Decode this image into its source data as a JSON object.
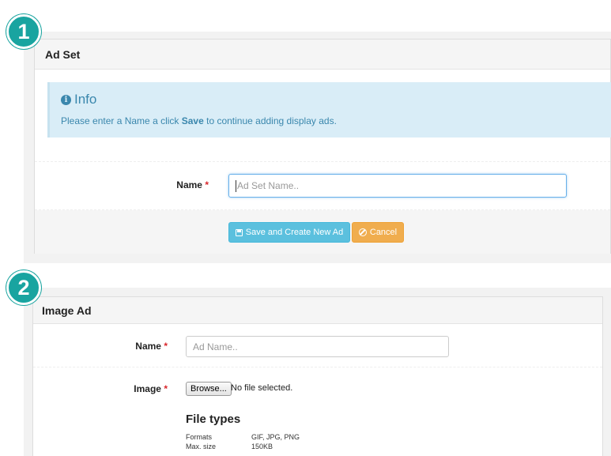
{
  "step1": {
    "badge": "1",
    "header": "Ad Set",
    "info": {
      "title": "Info",
      "text_before": "Please enter a Name a click ",
      "text_bold": "Save",
      "text_after": " to continue adding display ads."
    },
    "name_label": "Name",
    "required_mark": "*",
    "name_placeholder": "Ad Set Name..",
    "save_button": "Save and Create New Ad",
    "cancel_button": "Cancel"
  },
  "step2": {
    "badge": "2",
    "header": "Image Ad",
    "name_label": "Name",
    "required_mark": "*",
    "name_placeholder": "Ad Name..",
    "image_label": "Image",
    "browse_button": "Browse...",
    "no_file_text": "No file selected.",
    "file_types": {
      "title": "File types",
      "rows": [
        {
          "key": "Formats",
          "value": "GIF, JPG, PNG"
        },
        {
          "key": "Max. size",
          "value": "150KB"
        }
      ]
    }
  },
  "colors": {
    "badge": "#19a4a0",
    "info_bg": "#d9edf7",
    "info_text": "#3a87ad",
    "save_button": "#5bc0de",
    "cancel_button": "#f0ad4e",
    "required": "#d9262b"
  },
  "icons": {
    "info": "info-circle-icon",
    "save": "floppy-disk-icon",
    "cancel": "ban-icon"
  }
}
